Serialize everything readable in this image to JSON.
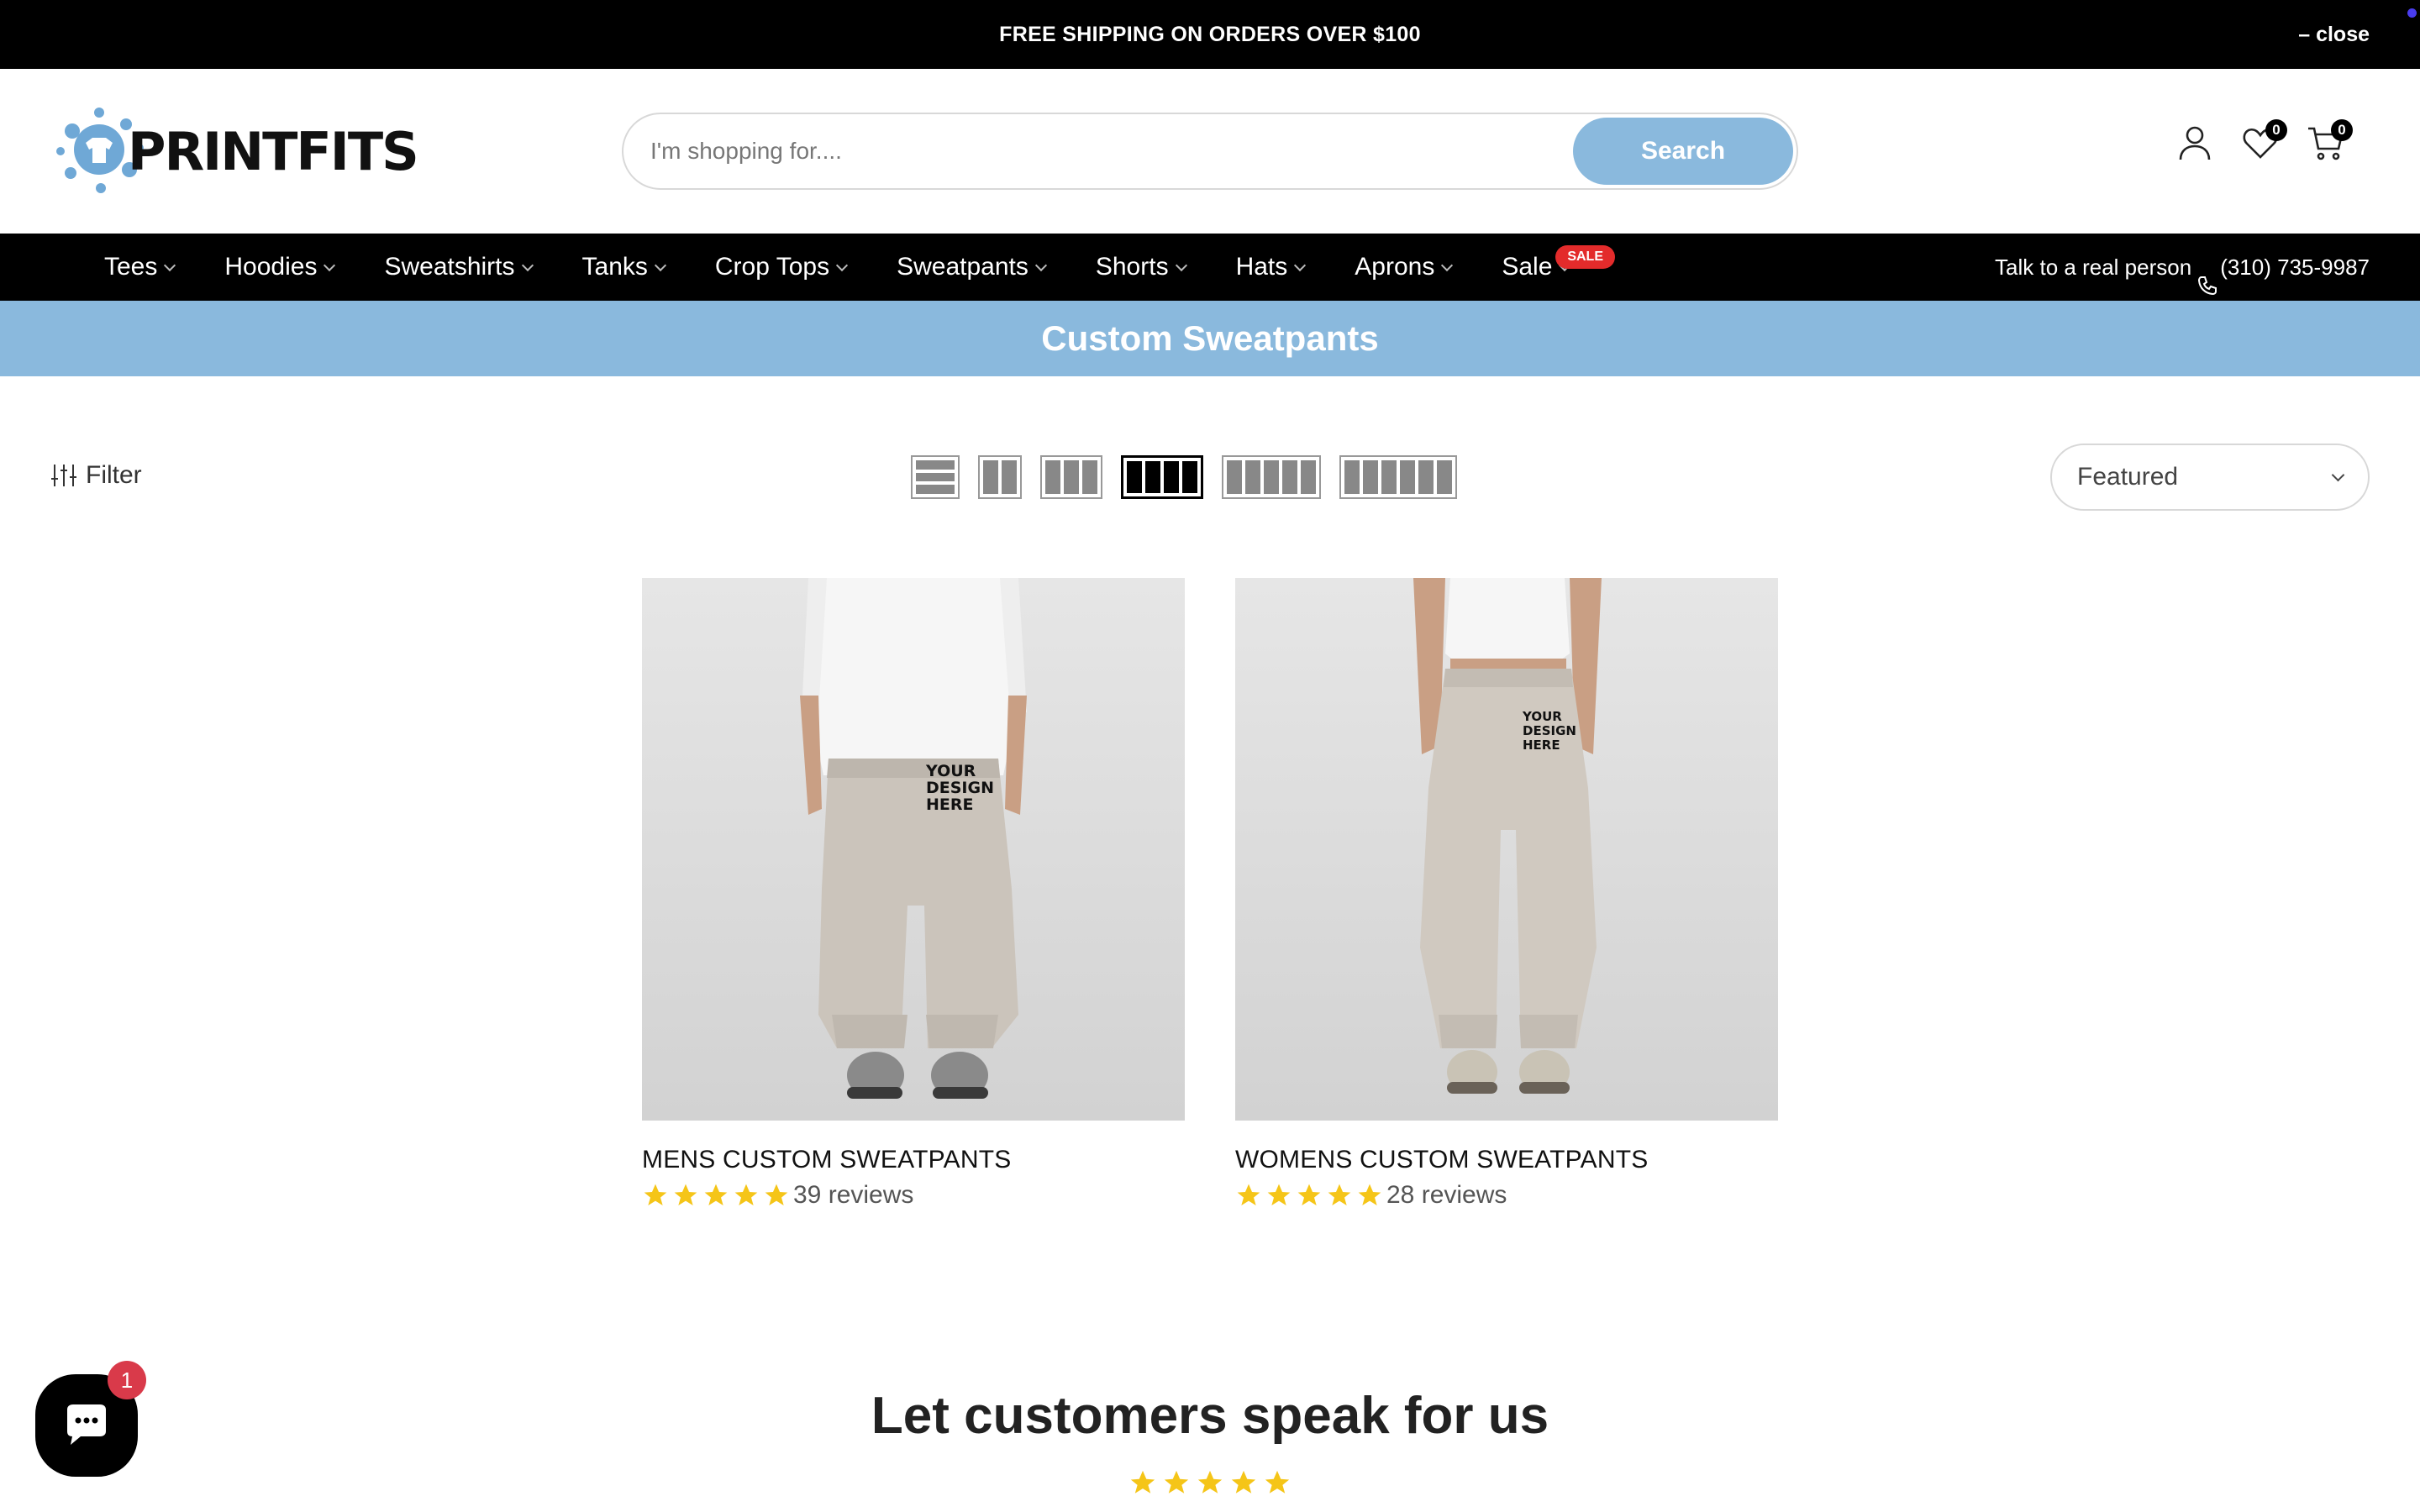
{
  "announcement": {
    "message": "FREE SHIPPING ON ORDERS OVER $100",
    "close_label": "– close"
  },
  "header": {
    "logo_text": "PRINTFITS",
    "search": {
      "placeholder": "I'm shopping for....",
      "button_label": "Search"
    },
    "wishlist_count": "0",
    "cart_count": "0",
    "icons": [
      "user-icon",
      "heart-icon",
      "cart-icon"
    ]
  },
  "nav": {
    "items": [
      {
        "label": "Tees"
      },
      {
        "label": "Hoodies"
      },
      {
        "label": "Sweatshirts"
      },
      {
        "label": "Tanks"
      },
      {
        "label": "Crop Tops"
      },
      {
        "label": "Sweatpants"
      },
      {
        "label": "Shorts"
      },
      {
        "label": "Hats"
      },
      {
        "label": "Aprons"
      },
      {
        "label": "Sale",
        "badge": "SALE"
      }
    ],
    "contact_label": "Talk to a real person",
    "phone": "(310) 735-9987"
  },
  "collection": {
    "title": "Custom Sweatpants"
  },
  "toolbar": {
    "filter_label": "Filter",
    "sort_value": "Featured",
    "active_grid": "4-columns"
  },
  "products": [
    {
      "title": "MENS CUSTOM SWEATPANTS",
      "reviews": "39 reviews",
      "rating": 5,
      "mockup_text": [
        "YOUR",
        "DESIGN",
        "HERE"
      ]
    },
    {
      "title": "WOMENS CUSTOM SWEATPANTS",
      "reviews": "28 reviews",
      "rating": 5,
      "mockup_text": [
        "YOUR",
        "DESIGN",
        "HERE"
      ]
    }
  ],
  "reviews_section": {
    "title": "Let customers speak for us",
    "rating": 5
  },
  "chat": {
    "badge": "1"
  },
  "colors": {
    "accent_blue": "#8ab9dd",
    "star_yellow": "#f5c518",
    "sale_red": "#e32b2b"
  }
}
